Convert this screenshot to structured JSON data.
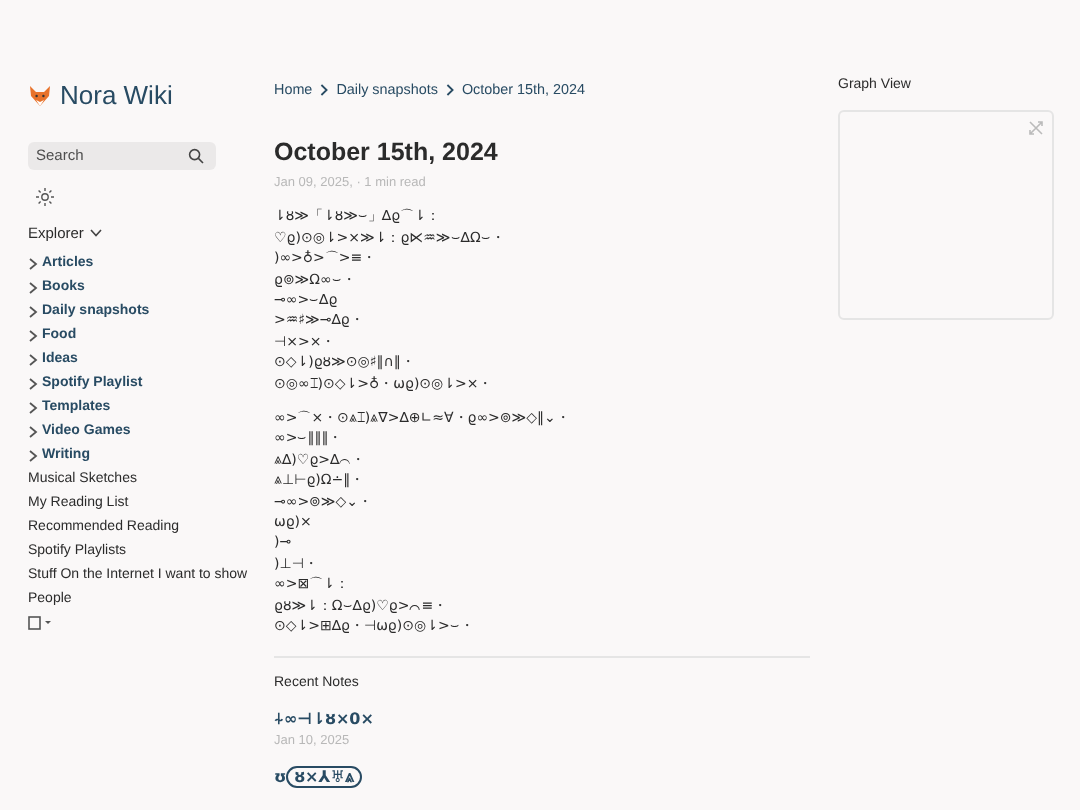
{
  "site": {
    "title": "Nora Wiki"
  },
  "search": {
    "placeholder": "Search"
  },
  "explorer": {
    "title": "Explorer",
    "expanded": true,
    "items": [
      {
        "kind": "folder",
        "label": "Articles",
        "expanded": false
      },
      {
        "kind": "folder",
        "label": "Books",
        "expanded": false
      },
      {
        "kind": "folder",
        "label": "Daily snapshots",
        "expanded": false
      },
      {
        "kind": "folder",
        "label": "Food",
        "expanded": false
      },
      {
        "kind": "folder",
        "label": "Ideas",
        "expanded": false
      },
      {
        "kind": "folder",
        "label": "Spotify Playlist",
        "expanded": false
      },
      {
        "kind": "folder",
        "label": "Templates",
        "expanded": false
      },
      {
        "kind": "folder",
        "label": "Video Games",
        "expanded": false
      },
      {
        "kind": "folder",
        "label": "Writing",
        "expanded": false
      },
      {
        "kind": "file",
        "label": "Musical Sketches"
      },
      {
        "kind": "file",
        "label": "My Reading List"
      },
      {
        "kind": "file",
        "label": "Recommended Reading"
      },
      {
        "kind": "file",
        "label": "Spotify Playlists"
      },
      {
        "kind": "file",
        "label": "Stuff On the Internet I want to show"
      },
      {
        "kind": "file",
        "label": "People"
      }
    ]
  },
  "breadcrumbs": [
    "Home",
    "Daily snapshots",
    "October 15th, 2024"
  ],
  "article": {
    "title": "October 15th, 2024",
    "meta": "Jan 09, 2025, · 1 min read",
    "paragraphs": [
      [
        "⇂ȣ≫「⇂ȣ≫⌣」∆ϱ⌒⇂：",
        "♡ϱ)⊙◎⇂>⨯≫⇂：ϱ⋉♒≫⌣∆Ω⌣・",
        ")∞>♁>⌒>≡・",
        "ϱ⊚≫Ω∞⌣・",
        "⊸∞>⌣∆ϱ",
        ">♒♯≫⊸∆ϱ・",
        "⊣⨯>⨯・",
        "⊙◇⇂)ϱȣ≫⊙◎♯‖∩‖・",
        "⊙◎∞⌶)⊙◇⇂>♁・⍵ϱ)⊙◎⇂>⨯・"
      ],
      [
        "∞>⌒⨯・⊙⩓⌶)⩓∇>∆⊕∟≈∀・ϱ∞>⊚≫◇‖⌄・",
        "∞>⌣‖‖‖・",
        "⩓∆)♡ϱ>∆⌒・",
        "⩓⊥⊢ϱ)Ω∸‖・",
        "⊸∞>⊚≫◇⌄・",
        "⍵ϱ)⨯",
        ")⊸",
        ")⊥⊣・",
        "∞>⊠⌒⇂：",
        "ϱȣ≫⇂：Ω⌣∆ϱ)♡ϱ>⌒≡・",
        "⊙◇⇂>⊞∆ϱ・⊣⍵ϱ)⊙◎⇂>⌣・"
      ]
    ]
  },
  "recent": {
    "title": "Recent Notes",
    "notes": [
      {
        "title": "⍭∞⊣⇂ȣ⨯0⨯",
        "date": "Jan 10, 2025",
        "prefix": "ʊ",
        "tag": "ȣ⨯⅄♅⩓"
      }
    ]
  },
  "graph": {
    "title": "Graph View"
  }
}
